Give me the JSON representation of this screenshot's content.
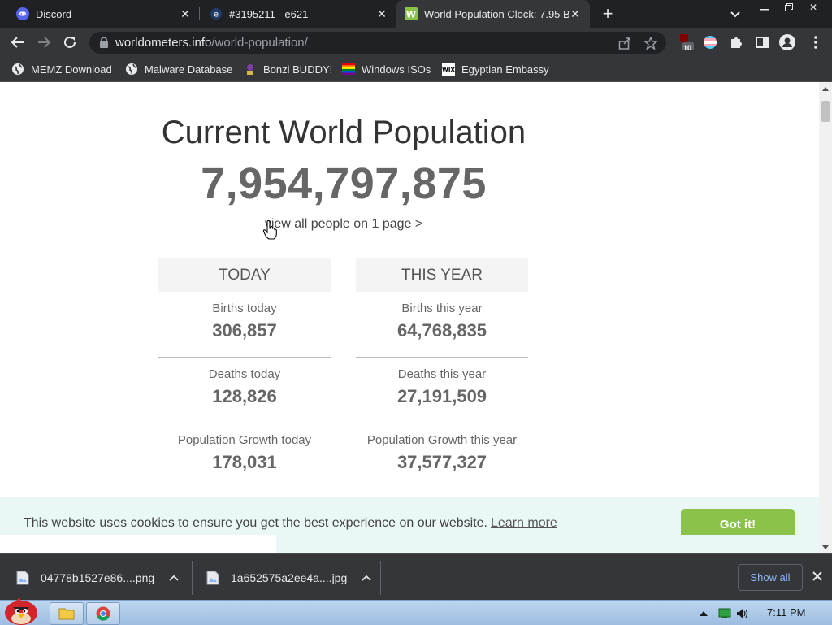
{
  "browser": {
    "tabs": [
      {
        "title": "Discord",
        "icon": "discord-icon",
        "active": false
      },
      {
        "title": "#3195211 - e621",
        "icon": "e621-icon",
        "active": false
      },
      {
        "title": "World Population Clock: 7.95 B",
        "icon": "worldometers-icon",
        "active": true
      }
    ],
    "new_tab": "+",
    "url_host": "worldometers.info",
    "url_path": "/world-population/",
    "extension_badge": "10",
    "bookmarks": [
      {
        "label": "MEMZ Download",
        "icon": "globe-icon"
      },
      {
        "label": "Malware Database",
        "icon": "globe-icon"
      },
      {
        "label": "Bonzi BUDDY!",
        "icon": "bonzi-icon"
      },
      {
        "label": "Windows ISOs",
        "icon": "rainbow-flag-icon"
      },
      {
        "label": "Egyptian Embassy",
        "icon": "wix-icon"
      }
    ]
  },
  "page": {
    "title": "Current World Population",
    "counter": "7,954,797,875",
    "view_all_link": "view all people on 1 page >",
    "today": {
      "heading": "TODAY",
      "stats": [
        {
          "label": "Births today",
          "value": "306,857"
        },
        {
          "label": "Deaths today",
          "value": "128,826"
        },
        {
          "label": "Population Growth today",
          "value": "178,031"
        }
      ]
    },
    "this_year": {
      "heading": "THIS YEAR",
      "stats": [
        {
          "label": "Births this year",
          "value": "64,768,835"
        },
        {
          "label": "Deaths this year",
          "value": "27,191,509"
        },
        {
          "label": "Population Growth this year",
          "value": "37,577,327"
        }
      ]
    },
    "cookie": {
      "message": "This website uses cookies to ensure you get the best experience on our website.",
      "learn_more": "Learn more",
      "accept": "Got it!",
      "accept_color": "#8bc34a"
    }
  },
  "downloads": {
    "items": [
      {
        "name": "04778b1527e86....png"
      },
      {
        "name": "1a652575a2ee4a....jpg"
      }
    ],
    "show_all": "Show all"
  },
  "taskbar": {
    "clock": "7:11 PM"
  }
}
